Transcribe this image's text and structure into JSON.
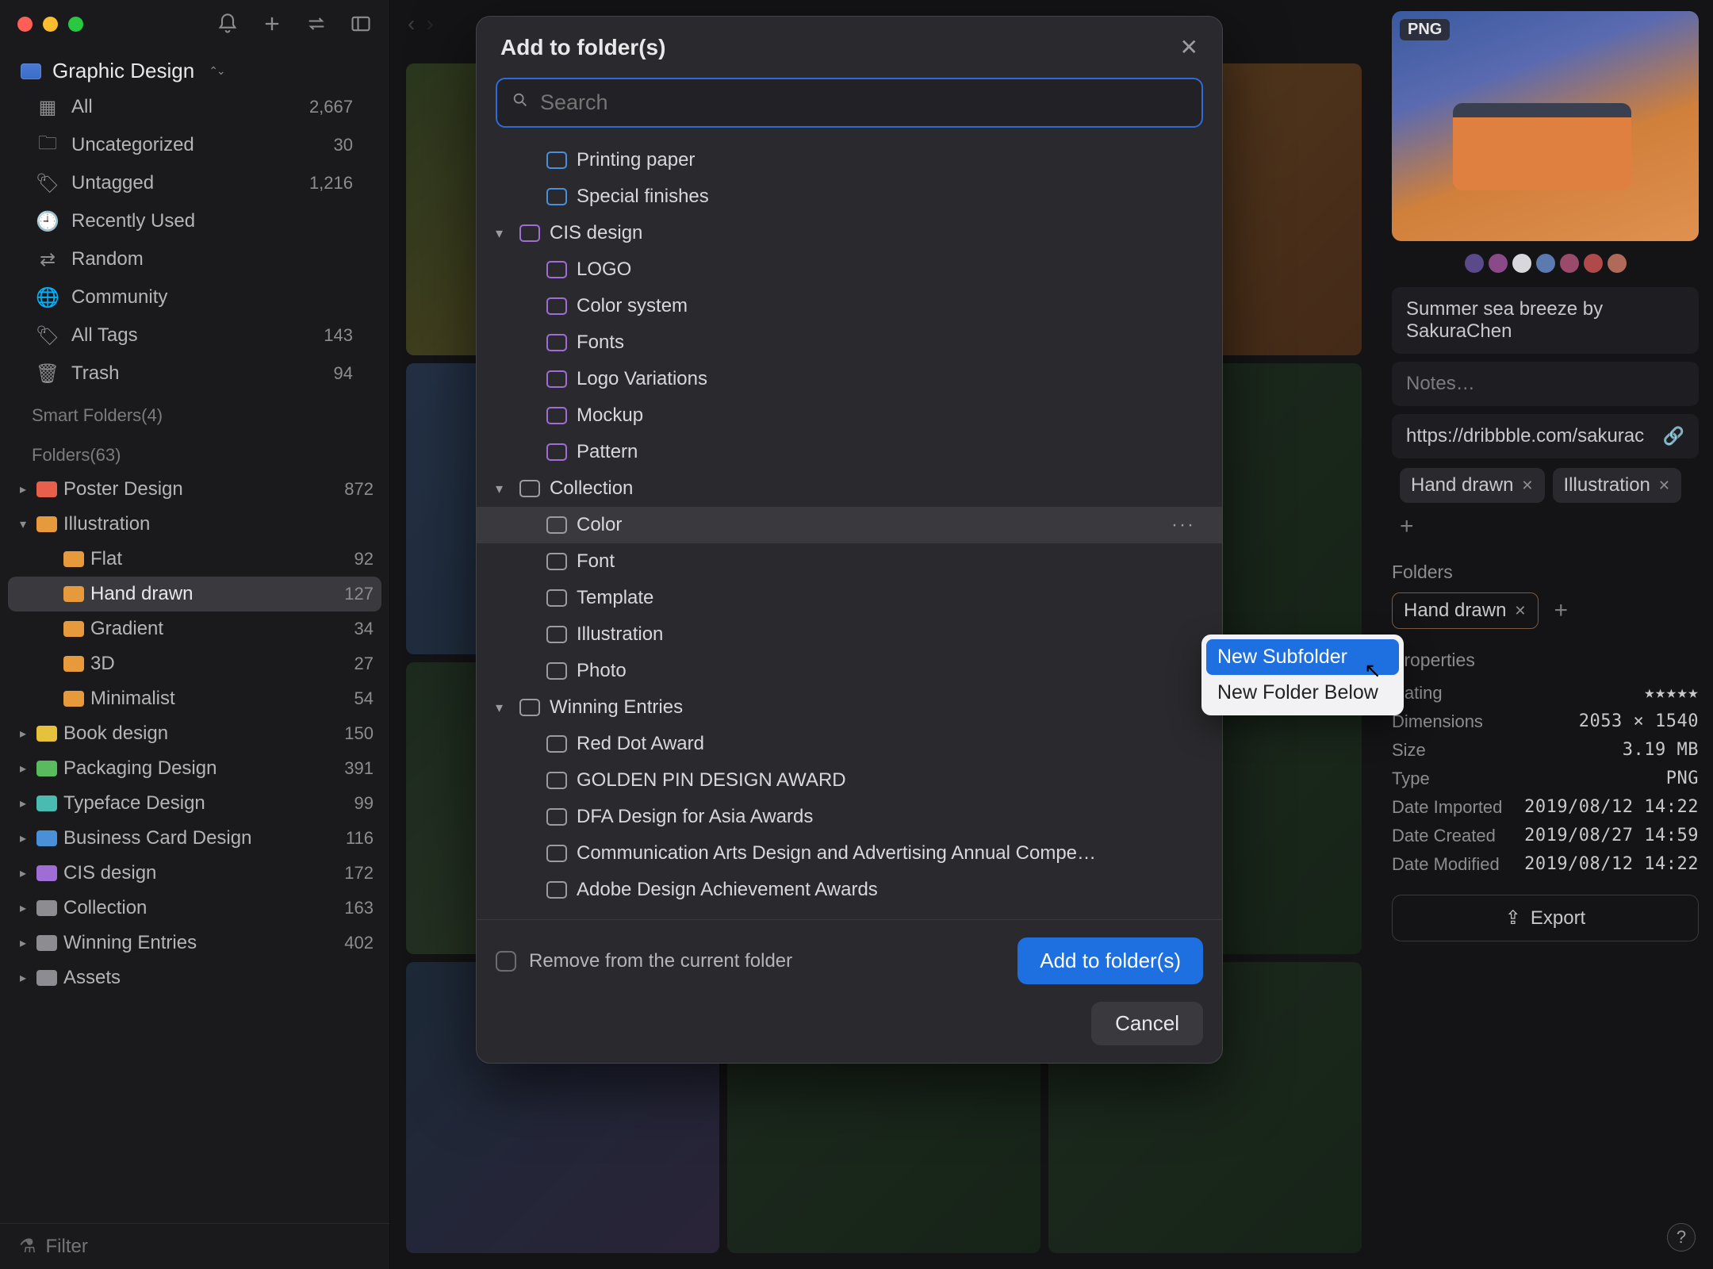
{
  "library_name": "Graphic Design",
  "sidebar_nav": [
    {
      "icon": "grid",
      "label": "All",
      "count": "2,667"
    },
    {
      "icon": "folder",
      "label": "Uncategorized",
      "count": "30"
    },
    {
      "icon": "tag",
      "label": "Untagged",
      "count": "1,216"
    },
    {
      "icon": "clock",
      "label": "Recently Used",
      "count": ""
    },
    {
      "icon": "shuffle",
      "label": "Random",
      "count": ""
    },
    {
      "icon": "globe",
      "label": "Community",
      "count": ""
    },
    {
      "icon": "tags",
      "label": "All Tags",
      "count": "143"
    },
    {
      "icon": "trash",
      "label": "Trash",
      "count": "94"
    }
  ],
  "smart_folders_h": "Smart Folders(4)",
  "folders_h": "Folders(63)",
  "folders": [
    {
      "name": "Poster Design",
      "count": "872",
      "cls": "fi-red",
      "disc": "▸"
    },
    {
      "name": "Illustration",
      "count": "",
      "cls": "fi-orange",
      "disc": "▾",
      "open": true,
      "children": [
        {
          "name": "Flat",
          "count": "92"
        },
        {
          "name": "Hand drawn",
          "count": "127",
          "selected": true
        },
        {
          "name": "Gradient",
          "count": "34"
        },
        {
          "name": "3D",
          "count": "27"
        },
        {
          "name": "Minimalist",
          "count": "54"
        }
      ]
    },
    {
      "name": "Book design",
      "count": "150",
      "cls": "fi-yellow",
      "disc": "▸"
    },
    {
      "name": "Packaging Design",
      "count": "391",
      "cls": "fi-green",
      "disc": "▸"
    },
    {
      "name": "Typeface Design",
      "count": "99",
      "cls": "fi-teal",
      "disc": "▸"
    },
    {
      "name": "Business Card Design",
      "count": "116",
      "cls": "fi-blue",
      "disc": "▸"
    },
    {
      "name": "CIS design",
      "count": "172",
      "cls": "fi-purple",
      "disc": "▸"
    },
    {
      "name": "Collection",
      "count": "163",
      "cls": "fi-gray",
      "disc": "▸"
    },
    {
      "name": "Winning Entries",
      "count": "402",
      "cls": "fi-gray",
      "disc": "▸"
    },
    {
      "name": "Assets",
      "count": "",
      "cls": "fi-gray",
      "disc": "▸"
    }
  ],
  "filter_placeholder": "Filter",
  "modal": {
    "title": "Add to folder(s)",
    "search_placeholder": "Search",
    "entries": [
      {
        "level": 1,
        "cls": "tf-blue",
        "label": "Printing paper"
      },
      {
        "level": 1,
        "cls": "tf-blue",
        "label": "Special finishes"
      },
      {
        "level": 0,
        "cls": "tf-purple",
        "label": "CIS design",
        "disc": "▾"
      },
      {
        "level": 1,
        "cls": "tf-purple",
        "label": "LOGO"
      },
      {
        "level": 1,
        "cls": "tf-purple",
        "label": "Color system"
      },
      {
        "level": 1,
        "cls": "tf-purple",
        "label": "Fonts"
      },
      {
        "level": 1,
        "cls": "tf-purple",
        "label": "Logo Variations"
      },
      {
        "level": 1,
        "cls": "tf-purple",
        "label": "Mockup"
      },
      {
        "level": 1,
        "cls": "tf-purple",
        "label": "Pattern"
      },
      {
        "level": 0,
        "cls": "tf-str",
        "label": "Collection",
        "disc": "▾"
      },
      {
        "level": 1,
        "cls": "tf-str",
        "label": "Color",
        "hover": true
      },
      {
        "level": 1,
        "cls": "tf-str",
        "label": "Font"
      },
      {
        "level": 1,
        "cls": "tf-str",
        "label": "Template"
      },
      {
        "level": 1,
        "cls": "tf-str",
        "label": "Illustration"
      },
      {
        "level": 1,
        "cls": "tf-str",
        "label": "Photo"
      },
      {
        "level": 0,
        "cls": "tf-str",
        "label": "Winning Entries",
        "disc": "▾"
      },
      {
        "level": 1,
        "cls": "tf-str",
        "label": "Red Dot Award"
      },
      {
        "level": 1,
        "cls": "tf-str",
        "label": "GOLDEN PIN DESIGN AWARD"
      },
      {
        "level": 1,
        "cls": "tf-str",
        "label": "DFA Design for Asia Awards"
      },
      {
        "level": 1,
        "cls": "tf-str",
        "label": "Communication Arts Design and Advertising Annual Compe…"
      },
      {
        "level": 1,
        "cls": "tf-str",
        "label": "Adobe Design Achievement Awards"
      }
    ],
    "remove_label": "Remove from the current folder",
    "confirm": "Add to folder(s)",
    "cancel": "Cancel"
  },
  "context_menu": {
    "new_sub": "New Subfolder",
    "new_below": "New Folder Below"
  },
  "details": {
    "badge": "PNG",
    "swatches": [
      "#5a4a8a",
      "#8a4a8a",
      "#d8d8dc",
      "#5a7ab0",
      "#9a4a6a",
      "#b04a4a",
      "#b06a5a"
    ],
    "title": "Summer sea breeze by SakuraChen",
    "notes_placeholder": "Notes…",
    "url": "https://dribbble.com/sakurac",
    "tags": [
      "Hand drawn",
      "Illustration"
    ],
    "folders_h": "Folders",
    "folder_chip": "Hand drawn",
    "props_h": "Properties",
    "props": [
      {
        "k": "Rating",
        "v": "★★★★★",
        "stars": true
      },
      {
        "k": "Dimensions",
        "v": "2053 × 1540"
      },
      {
        "k": "Size",
        "v": "3.19 MB"
      },
      {
        "k": "Type",
        "v": "PNG"
      },
      {
        "k": "Date Imported",
        "v": "2019/08/12 14:22"
      },
      {
        "k": "Date Created",
        "v": "2019/08/27 14:59"
      },
      {
        "k": "Date Modified",
        "v": "2019/08/12 14:22"
      }
    ],
    "export": "Export"
  }
}
